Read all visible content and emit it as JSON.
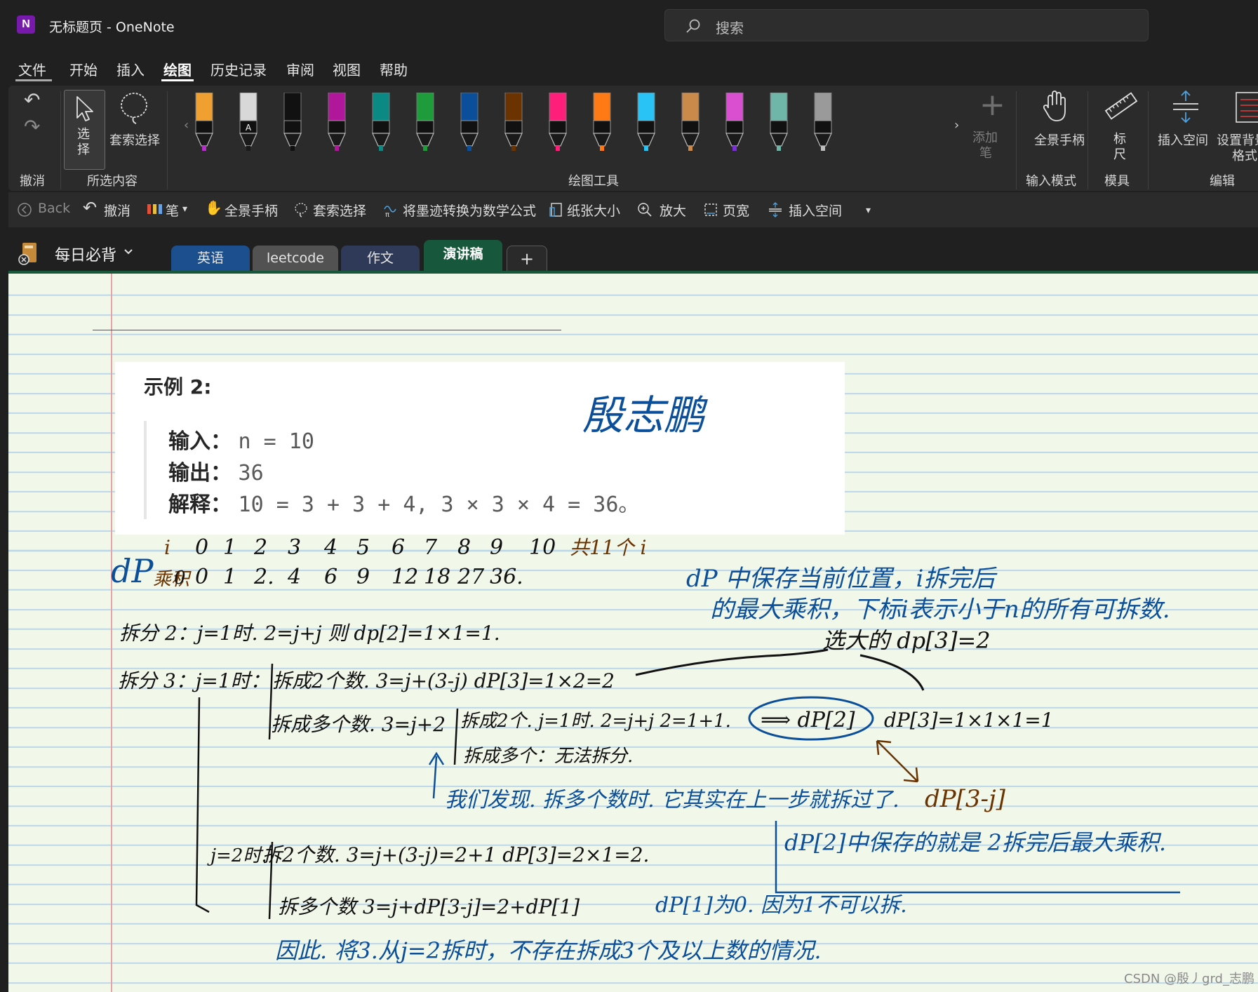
{
  "window": {
    "title": "无标题页 - OneNote",
    "app_logo": "N"
  },
  "search": {
    "placeholder": "搜索"
  },
  "menu": {
    "items": [
      "文件",
      "开始",
      "插入",
      "绘图",
      "历史记录",
      "审阅",
      "视图",
      "帮助"
    ],
    "active": "绘图"
  },
  "ribbon": {
    "undo_group_label": "撤消",
    "select_tool_label": [
      "选",
      "择"
    ],
    "lasso_label": "套索选择",
    "selection_group_label": "所选内容",
    "drawing_tools_label": "绘图工具",
    "add_pen_label": [
      "添加",
      "笔"
    ],
    "full_pan_label": "全景手柄",
    "input_mode_label": "输入模式",
    "ruler_label": [
      "标",
      "尺"
    ],
    "stencil_label": "模具",
    "insert_space_label": "插入空间",
    "background_format_label": [
      "设置背景",
      "格式"
    ],
    "edit_label": "编辑",
    "pens": [
      {
        "color": "#f0a030",
        "tip": "#b530c8"
      },
      {
        "color": "#d8d8d8",
        "tip": "#1a1a1a",
        "marker": "A"
      },
      {
        "color": "#111111",
        "tip": "#111111"
      },
      {
        "color": "#b0179a",
        "tip": "#b0179a"
      },
      {
        "color": "#0a8a82",
        "tip": "#0a8a82"
      },
      {
        "color": "#1e9b3a",
        "tip": "#1e9b3a"
      },
      {
        "color": "#0b4f9a",
        "tip": "#0b4f9a"
      },
      {
        "color": "#6b3300",
        "tip": "#6b3300"
      },
      {
        "color": "#ff1f7a",
        "tip": "#ff1f7a"
      },
      {
        "color": "#ff7a14",
        "tip": "#ff7a14"
      },
      {
        "color": "#29c4f5",
        "tip": "#29c4f5"
      },
      {
        "color": "#c98a4a",
        "tip": "#c98a4a"
      },
      {
        "color": "#d94fd0",
        "tip": "#7a2fd8"
      },
      {
        "color": "#6fb6a8",
        "tip": "#6fb6a8"
      },
      {
        "color": "#9a9a9a",
        "tip": "#bdbdbd"
      }
    ]
  },
  "quickbar": {
    "items": [
      "Back",
      "撤消",
      "笔",
      "全景手柄",
      "套索选择",
      "将墨迹转换为数学公式",
      "纸张大小",
      "放大",
      "页宽",
      "插入空间"
    ]
  },
  "notebook": {
    "name": "每日必背"
  },
  "sections": [
    {
      "label": "英语",
      "color": "#1b4f8e"
    },
    {
      "label": "leetcode",
      "color": "#525252"
    },
    {
      "label": "作文",
      "color": "#2e3a58"
    },
    {
      "label": "演讲稿",
      "color": "#17583c"
    }
  ],
  "clip": {
    "heading": "示例 2:",
    "rows": [
      {
        "key": "输入：",
        "value": "n = 10"
      },
      {
        "key": "输出：",
        "value": "36"
      },
      {
        "key": "解释：",
        "value": "10 = 3 + 3 + 4, 3 × 3 × 4 = 36。"
      }
    ]
  },
  "ink": {
    "signature": "殷志鹏",
    "row_i_label": "i",
    "row_i": [
      "0",
      "1",
      "2",
      "3",
      "4",
      "5",
      "6",
      "7",
      "8",
      "9",
      "10"
    ],
    "row_i_note": "共11个 i",
    "dp_label": "dP",
    "row_product_label": "乘积",
    "row_product": [
      "0",
      "0",
      "1",
      "2.",
      "4",
      "6",
      "9",
      "12",
      "18",
      "27",
      "36."
    ],
    "note_dp_1": "dP 中保存当前位置，i拆完后",
    "note_dp_2": "的最大乘积，下标i表示小于n的所有可拆数.",
    "line_split2": "拆分 2：j=1时. 2=j+j  则 dp[2]=1×1=1.",
    "note_choose": "选大的 dp[3]=2",
    "line_split3_head": "拆分 3：j=1时：",
    "line_split3_a": "拆成2个数. 3=j+(3-j)   dP[3]=1×2=2",
    "line_split3_b": "拆成多个数. 3=j+2",
    "line_split3_b1": "拆成2个. j=1时. 2=j+j   2=1+1.",
    "dp2_circled": "⟹ dP[2]",
    "line_split3_b1_result": "dP[3]=1×1×1=1",
    "line_split3_b2": "拆成多个：无法拆分.",
    "note_found": "我们发现. 拆多个数时. 它其实在上一步就拆过了.",
    "note_found_dp": "dP[3-j]",
    "note_dp2_meaning": "dP[2]中保存的就是 2拆完后最大乘积.",
    "line_j2": "j=2时.",
    "line_j2_a": "拆2个数. 3=j+(3-j)=2+1    dP[3]=2×1=2.",
    "line_j2_b": "拆多个数 3=j+dP[3-j]=2+dP[1]",
    "note_dp1": "dP[1]为0. 因为1不可以拆.",
    "conclusion": "因此. 将3.从j=2拆时，不存在拆成3个及以上数的情况."
  },
  "watermark": "CSDN @殷丿grd_志鹏",
  "colors": {
    "accent": "#17583c",
    "ink_blue": "#0b4f9a",
    "ink_black": "#111111",
    "ink_brown": "#6b3300"
  }
}
